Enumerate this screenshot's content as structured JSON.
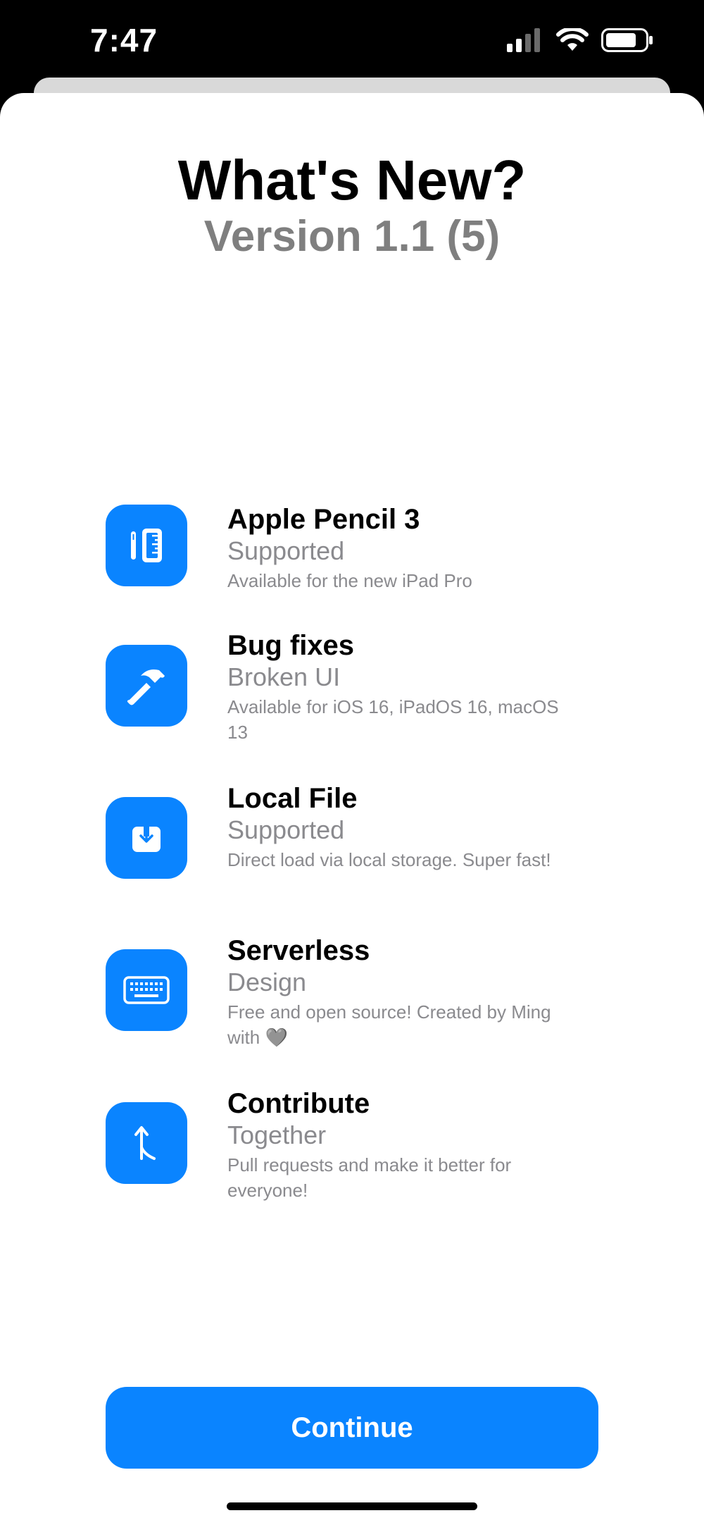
{
  "status": {
    "time": "7:47"
  },
  "header": {
    "title": "What's New?",
    "version": "Version 1.1 (5)"
  },
  "features": [
    {
      "icon": "pencil-ruler-icon",
      "title": "Apple Pencil 3",
      "subtitle": "Supported",
      "description": "Available for the new iPad Pro"
    },
    {
      "icon": "hammer-icon",
      "title": "Bug fixes",
      "subtitle": "Broken UI",
      "description": "Available for iOS 16, iPadOS 16, macOS 13"
    },
    {
      "icon": "download-tray-icon",
      "title": "Local File",
      "subtitle": "Supported",
      "description": "Direct load via local storage. Super fast!"
    },
    {
      "icon": "keyboard-icon",
      "title": "Serverless",
      "subtitle": "Design",
      "description": "Free and open source! Created by Ming with 🩶"
    },
    {
      "icon": "merge-arrow-icon",
      "title": "Contribute",
      "subtitle": "Together",
      "description": "Pull requests and make it better for everyone!"
    }
  ],
  "footer": {
    "continue_label": "Continue"
  },
  "colors": {
    "accent": "#0a84ff",
    "secondary_text": "#8a8a8e"
  }
}
